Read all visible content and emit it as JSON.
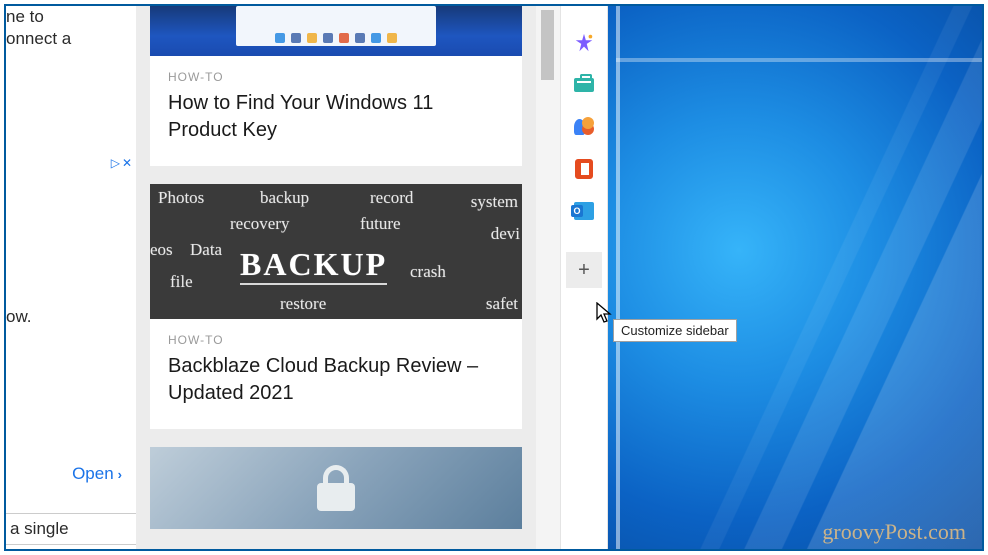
{
  "left": {
    "frag1": "ne to",
    "frag2": "onnect a",
    "frag3": "ow.",
    "frag4": "a single",
    "ad_play": "▷",
    "ad_close": "✕",
    "open_label": "Open",
    "open_chevron": "›"
  },
  "articles": [
    {
      "category": "HOW-TO",
      "title": "How to Find Your Windows 11 Product Key"
    },
    {
      "category": "HOW-TO",
      "title": "Backblaze Cloud Backup Review – Updated 2021"
    }
  ],
  "chalk": {
    "w1": "Photos",
    "w2": "backup",
    "w3": "record",
    "w4": "recovery",
    "w5": "future",
    "w6": "system",
    "w7": "eos",
    "w8": "Data",
    "w9": "devi",
    "w10": "file",
    "w11": "BACKUP",
    "w12": "crash",
    "w13": "restore",
    "w14": "safet"
  },
  "sidebar": {
    "items": [
      "copilot",
      "tools",
      "games",
      "office",
      "outlook"
    ],
    "plus": "+"
  },
  "tooltip": "Customize sidebar",
  "outlook_letter": "O",
  "watermark": "groovyPost.com"
}
